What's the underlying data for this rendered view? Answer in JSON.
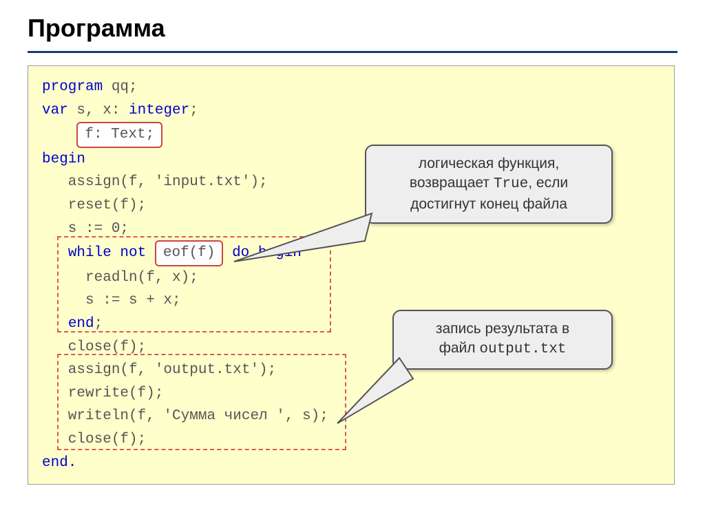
{
  "title": "Программа",
  "code": {
    "l1a": "program",
    "l1b": " qq;",
    "l2a": "var",
    "l2b": " s, x: ",
    "l2c": "integer",
    "l2d": ";",
    "l3_box": "f: Text;",
    "l4": "begin",
    "l5": "   assign(f, 'input.txt');",
    "l6": "   reset(f);",
    "l7": "   s := 0;",
    "l8a": "   ",
    "l8b": "while not",
    "l8c": " ",
    "l8_box": "eof(f)",
    "l8d": " ",
    "l8e": "do begin",
    "l9": "     readln(f, x);",
    "l10": "     s := s + x;",
    "l11a": "   ",
    "l11b": "end",
    "l11c": ";",
    "l12": "   close(f);",
    "l13": "   assign(f, 'output.txt');",
    "l14": "   rewrite(f);",
    "l15": "   writeln(f, 'Сумма чисел ', s);",
    "l16": "   close(f);",
    "l17": "end."
  },
  "callout1": {
    "t1": "логическая функция,",
    "t2a": "возвращает ",
    "t2b": "True",
    "t2c": ", если",
    "t3": "достигнут конец файла"
  },
  "callout2": {
    "t1": "запись результата в",
    "t2a": "файл ",
    "t2b": "output.txt"
  }
}
